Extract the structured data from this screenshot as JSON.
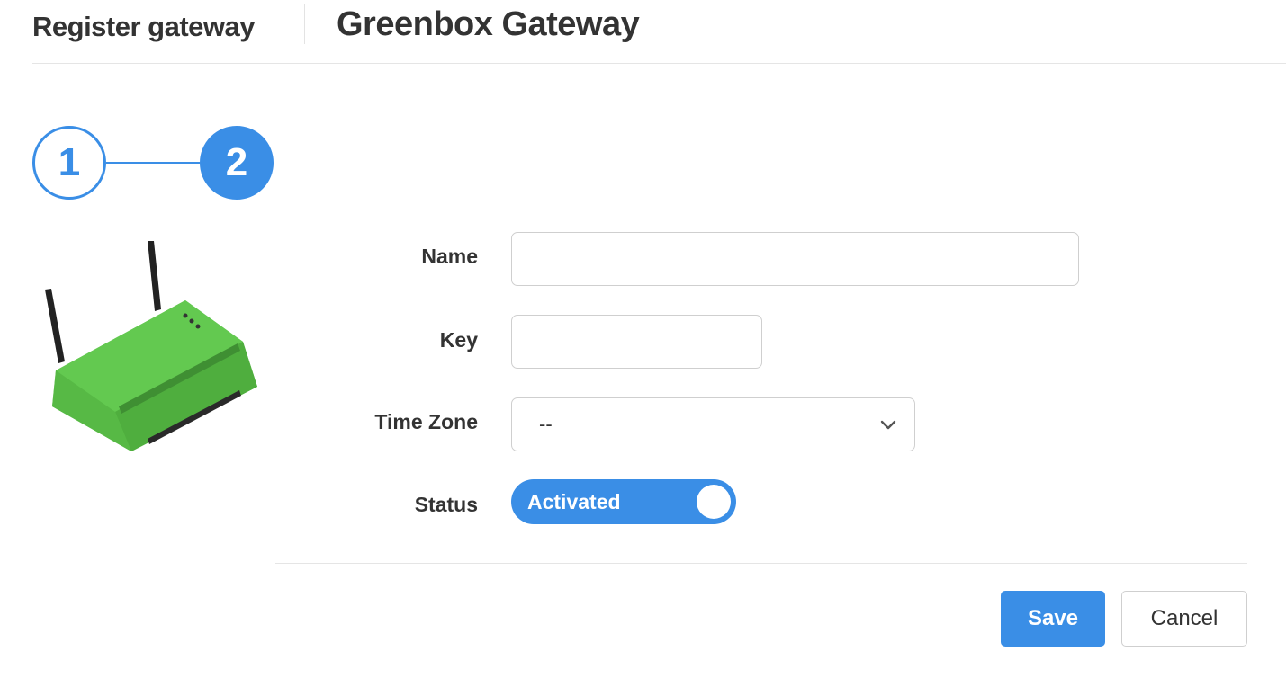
{
  "header": {
    "breadcrumb": "Register gateway",
    "title": "Greenbox Gateway"
  },
  "stepper": {
    "steps": [
      {
        "label": "1",
        "state": "done"
      },
      {
        "label": "2",
        "state": "active"
      }
    ],
    "accent_color": "#3a8ee6"
  },
  "device": {
    "icon": "gateway-router-image",
    "color": "#5cc24a"
  },
  "form": {
    "name": {
      "label": "Name",
      "value": "",
      "placeholder": ""
    },
    "key": {
      "label": "Key",
      "value": "",
      "placeholder": ""
    },
    "timezone": {
      "label": "Time Zone",
      "value": "--"
    },
    "status": {
      "label": "Status",
      "value": "Activated",
      "on": true
    }
  },
  "actions": {
    "save_label": "Save",
    "cancel_label": "Cancel"
  },
  "colors": {
    "primary": "#3a8ee6",
    "border": "#cfcfcf",
    "text": "#333333"
  }
}
